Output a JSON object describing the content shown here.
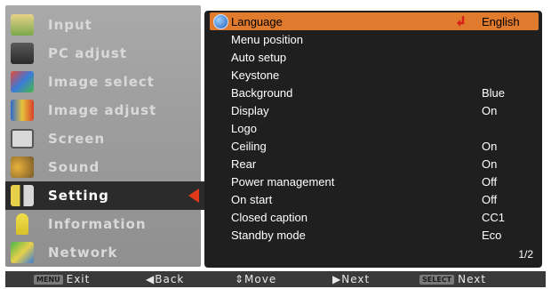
{
  "left_menu": {
    "items": [
      {
        "label": "Input",
        "icon": "input-icon"
      },
      {
        "label": "PC adjust",
        "icon": "pc-adjust-icon"
      },
      {
        "label": "Image select",
        "icon": "image-select-icon"
      },
      {
        "label": "Image adjust",
        "icon": "image-adjust-icon"
      },
      {
        "label": "Screen",
        "icon": "screen-icon"
      },
      {
        "label": "Sound",
        "icon": "sound-icon"
      },
      {
        "label": "Setting",
        "icon": "setting-icon",
        "active": true
      },
      {
        "label": "Information",
        "icon": "information-icon"
      },
      {
        "label": "Network",
        "icon": "network-icon"
      }
    ]
  },
  "setting_menu": {
    "rows": [
      {
        "name": "Language",
        "value": "English",
        "selected": true
      },
      {
        "name": "Menu position",
        "value": ""
      },
      {
        "name": "Auto setup",
        "value": ""
      },
      {
        "name": "Keystone",
        "value": ""
      },
      {
        "name": "Background",
        "value": "Blue"
      },
      {
        "name": "Display",
        "value": "On"
      },
      {
        "name": "Logo",
        "value": ""
      },
      {
        "name": "Ceiling",
        "value": "On"
      },
      {
        "name": "Rear",
        "value": "On"
      },
      {
        "name": "Power management",
        "value": "Off"
      },
      {
        "name": "On start",
        "value": "Off"
      },
      {
        "name": "Closed caption",
        "value": "CC1"
      },
      {
        "name": "Standby mode",
        "value": "Eco"
      }
    ],
    "page": "1/2"
  },
  "bottom_bar": {
    "exit_key": "MENU",
    "exit_label": "Exit",
    "back_label": "◀Back",
    "move_label": "⇕Move",
    "next_label": "▶Next",
    "select_key": "SELECT",
    "select_next_label": "Next"
  },
  "colors": {
    "highlight": "#e07a2c",
    "panel_dark": "#1f1f1f",
    "panel_gray": "#9a9a9a",
    "active_arrow": "#e03a1a"
  }
}
